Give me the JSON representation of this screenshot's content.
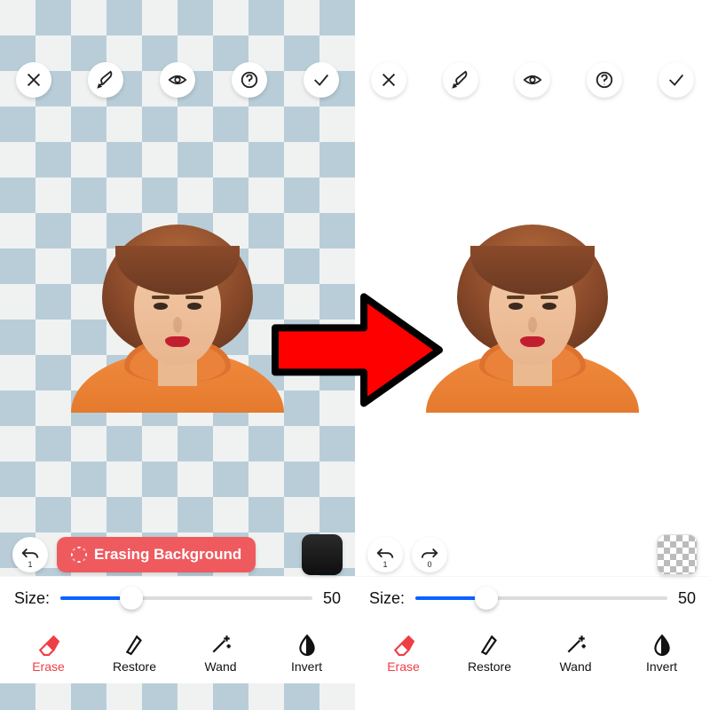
{
  "left": {
    "topbar_icons": [
      "close-icon",
      "brush-icon",
      "eye-icon",
      "help-icon",
      "check-icon"
    ],
    "undo_count": "1",
    "status_pill": "Erasing Background",
    "swatch": "black",
    "size_label": "Size:",
    "size_value": "50",
    "size_percent": 28,
    "tabs": {
      "erase": "Erase",
      "restore": "Restore",
      "wand": "Wand",
      "invert": "Invert"
    },
    "active_tab": "erase"
  },
  "right": {
    "topbar_icons": [
      "close-icon",
      "brush-icon",
      "eye-icon",
      "help-icon",
      "check-icon"
    ],
    "undo_count": "1",
    "redo_count": "0",
    "swatch": "checker",
    "size_label": "Size:",
    "size_value": "50",
    "size_percent": 28,
    "tabs": {
      "erase": "Erase",
      "restore": "Restore",
      "wand": "Wand",
      "invert": "Invert"
    },
    "active_tab": "erase"
  },
  "colors": {
    "accent": "#ef3e44",
    "pill": "#ef5a5f",
    "slider": "#0a62ff"
  }
}
